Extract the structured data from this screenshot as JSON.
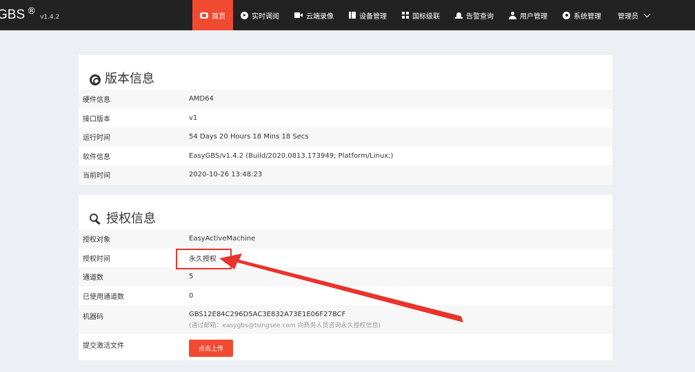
{
  "brand": {
    "name": "GBS",
    "reg": "®",
    "version": "v1.4.2"
  },
  "nav": {
    "items": [
      {
        "label": "首页",
        "icon": "home-icon",
        "active": true
      },
      {
        "label": "实时调阅",
        "icon": "play-circle-icon"
      },
      {
        "label": "云端录像",
        "icon": "video-camera-icon"
      },
      {
        "label": "设备管理",
        "icon": "bars-icon"
      },
      {
        "label": "国标级联",
        "icon": "grid-icon"
      },
      {
        "label": "告警查询",
        "icon": "bell-icon"
      },
      {
        "label": "用户管理",
        "icon": "user-icon"
      },
      {
        "label": "系统管理",
        "icon": "gear-icon"
      }
    ],
    "user": "管理员"
  },
  "version_panel": {
    "title": "版本信息",
    "rows": [
      {
        "key": "硬件信息",
        "value": "AMD64"
      },
      {
        "key": "接口版本",
        "value": "v1"
      },
      {
        "key": "运行时间",
        "value": "54 Days 20 Hours 18 Mins 18 Secs"
      },
      {
        "key": "软件信息",
        "value": "EasyGBS/v1.4.2 (Build/2020.0813.173949; Platform/Linux;)"
      },
      {
        "key": "当前时间",
        "value": "2020-10-26 13:48:23"
      }
    ]
  },
  "license_panel": {
    "title": "授权信息",
    "rows": [
      {
        "key": "授权对象",
        "value": "EasyActiveMachine"
      },
      {
        "key": "授权时间",
        "value": "永久授权"
      },
      {
        "key": "通道数",
        "value": "5"
      },
      {
        "key": "已使用通道数",
        "value": "0"
      },
      {
        "key": "机器码",
        "value": "GBS12E84C296D5AC3E832A73E1E06F27BCF",
        "note": "(通过邮箱：easygbs@tsingsee.com 向商务人员咨询永久授权信息)"
      },
      {
        "key": "提交激活文件",
        "button": "点击上传"
      }
    ]
  },
  "colors": {
    "accent": "#f04a31",
    "topbar": "#222222",
    "background": "#ecf0f5",
    "annotation": "#e8342b"
  }
}
